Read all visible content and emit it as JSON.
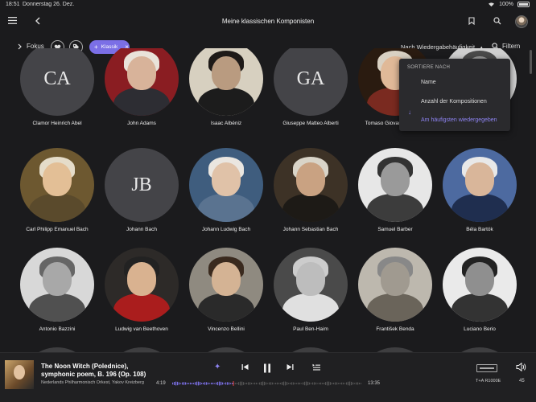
{
  "status": {
    "time": "18:51",
    "date": "Donnerstag 26. Dez.",
    "battery": "100%"
  },
  "header": {
    "title": "Meine klassischen Komponisten"
  },
  "filters": {
    "focus_label": "Fokus",
    "chip_label": "Klassik",
    "sort_label": "Nach Wiedergabehäufigkeit",
    "filter_label": "Filtern"
  },
  "sort_menu": {
    "header": "SORTIERE NACH",
    "options": [
      "Name",
      "Anzahl der Kompositionen",
      "Am häufigsten wiedergegeben"
    ],
    "active_index": 2
  },
  "composers": [
    {
      "name": "Clamor Heinrich Abel",
      "initials": "CA"
    },
    {
      "name": "John Adams",
      "initials": ""
    },
    {
      "name": "Isaac Albéniz",
      "initials": ""
    },
    {
      "name": "Giuseppe Matteo Alberti",
      "initials": "GA"
    },
    {
      "name": "Tomaso Giovanni Albinoni",
      "initials": ""
    },
    {
      "name": "Anton Arenski",
      "initials": ""
    },
    {
      "name": "Carl Philipp Emanuel Bach",
      "initials": ""
    },
    {
      "name": "Johann Bach",
      "initials": "JB"
    },
    {
      "name": "Johann Ludwig Bach",
      "initials": ""
    },
    {
      "name": "Johann Sebastian Bach",
      "initials": ""
    },
    {
      "name": "Samuel Barber",
      "initials": ""
    },
    {
      "name": "Béla Bartók",
      "initials": ""
    },
    {
      "name": "Antonio Bazzini",
      "initials": ""
    },
    {
      "name": "Ludwig van Beethoven",
      "initials": ""
    },
    {
      "name": "Vincenzo Bellini",
      "initials": ""
    },
    {
      "name": "Paul Ben-Haim",
      "initials": ""
    },
    {
      "name": "František Benda",
      "initials": ""
    },
    {
      "name": "Luciano Berio",
      "initials": ""
    }
  ],
  "player": {
    "title": "The Noon Witch (Polednice), symphonic poem, B. 196 (Op. 108)",
    "subtitle": "Nederlands Philharmonisch Orkest, Yakov Kreizberg",
    "elapsed": "4:19",
    "total": "13:35",
    "progress": 0.32,
    "device": "T+A R1000E",
    "volume": "45"
  },
  "colors": {
    "accent": "#7b6fe6",
    "background": "#1b1b1d"
  }
}
